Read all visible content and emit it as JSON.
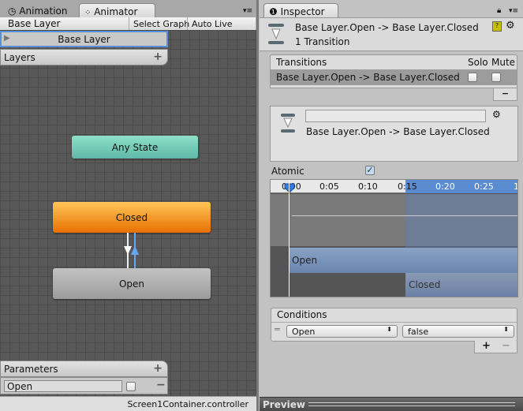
{
  "left_window": {
    "tabs": [
      {
        "label": "Animation",
        "icon": "clock-icon"
      },
      {
        "label": "Animator",
        "icon": "animator-icon"
      }
    ],
    "breadcrumb": "Base Layer",
    "select_graph": "Select Graph",
    "auto_live_link": "Auto Live Link",
    "layers": {
      "title": "Layers",
      "items": [
        "Base Layer"
      ],
      "add": "+"
    },
    "states": [
      {
        "label": "Any State",
        "color": "#6cc9b5"
      },
      {
        "label": "Closed",
        "color": "#f08a10"
      },
      {
        "label": "Open",
        "color": "#a8a8a8"
      }
    ],
    "parameters": {
      "title": "Parameters",
      "add": "+",
      "remove": "−",
      "items": [
        {
          "name": "Open",
          "value": false
        }
      ]
    },
    "footer": "Screen1Container.controller"
  },
  "inspector": {
    "tab": "Inspector",
    "title": "Base Layer.Open -> Base Layer.Closed",
    "subtitle": "1 Transition",
    "transitions": {
      "header": "Transitions",
      "solo": "Solo",
      "mute": "Mute",
      "rows": [
        {
          "name": "Base Layer.Open -> Base Layer.Closed",
          "solo": false,
          "mute": false
        }
      ],
      "remove": "−"
    },
    "transition_detail": {
      "name_value": "",
      "label": "Base Layer.Open -> Base Layer.Closed"
    },
    "atomic": {
      "label": "Atomic",
      "checked": true
    },
    "timeline": {
      "ticks": [
        "0:00",
        "0:05",
        "0:10",
        "0:15",
        "0:20",
        "0:25",
        "1"
      ],
      "source": "Open",
      "destination": "Closed",
      "accent": "#5a8ad0"
    },
    "conditions": {
      "title": "Conditions",
      "rows": [
        {
          "parameter": "Open",
          "value": "false"
        }
      ],
      "add": "+",
      "remove": "−"
    },
    "preview": "Preview"
  }
}
